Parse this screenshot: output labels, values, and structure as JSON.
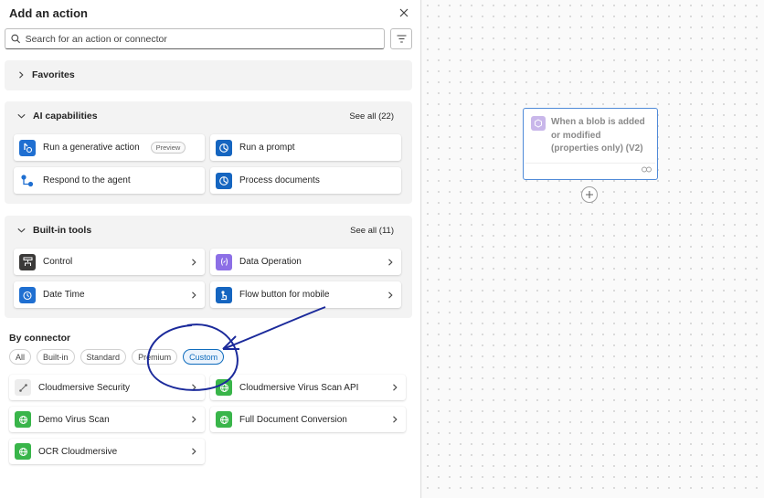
{
  "panel": {
    "title": "Add an action",
    "search_placeholder": "Search for an action or connector"
  },
  "favorites": {
    "title": "Favorites"
  },
  "ai": {
    "title": "AI capabilities",
    "see_all": "See all (22)",
    "items": [
      {
        "label": "Run a generative action",
        "badge": "Preview",
        "icon": "generative-action-icon"
      },
      {
        "label": "Run a prompt",
        "icon": "prompt-icon"
      },
      {
        "label": "Respond to the agent",
        "icon": "agent-icon"
      },
      {
        "label": "Process documents",
        "icon": "documents-icon"
      }
    ]
  },
  "builtin": {
    "title": "Built-in tools",
    "see_all": "See all (11)",
    "items": [
      {
        "label": "Control",
        "icon": "control-icon"
      },
      {
        "label": "Data Operation",
        "icon": "data-operation-icon"
      },
      {
        "label": "Date Time",
        "icon": "clock-icon"
      },
      {
        "label": "Flow button for mobile",
        "icon": "mobile-button-icon"
      }
    ]
  },
  "by_connector": {
    "title": "By connector",
    "chips": [
      "All",
      "Built-in",
      "Standard",
      "Premium",
      "Custom"
    ],
    "selected_chip": "Custom",
    "items": [
      {
        "label": "Cloudmersive Security",
        "icon": "connector-icon"
      },
      {
        "label": "Cloudmersive Virus Scan API",
        "icon": "globe-icon"
      },
      {
        "label": "Demo Virus Scan",
        "icon": "globe-icon"
      },
      {
        "label": "Full Document Conversion",
        "icon": "globe-icon"
      },
      {
        "label": "OCR Cloudmersive",
        "icon": "globe-icon"
      }
    ]
  },
  "canvas": {
    "trigger_text": "When a blob is added or modified (properties only) (V2)"
  },
  "colors": {
    "accent": "#0f6cbd",
    "annotation_ink": "#1b2a9b",
    "ai_blue": "#1f6fd1",
    "purple": "#8c6fe6",
    "green": "#39b54a"
  }
}
